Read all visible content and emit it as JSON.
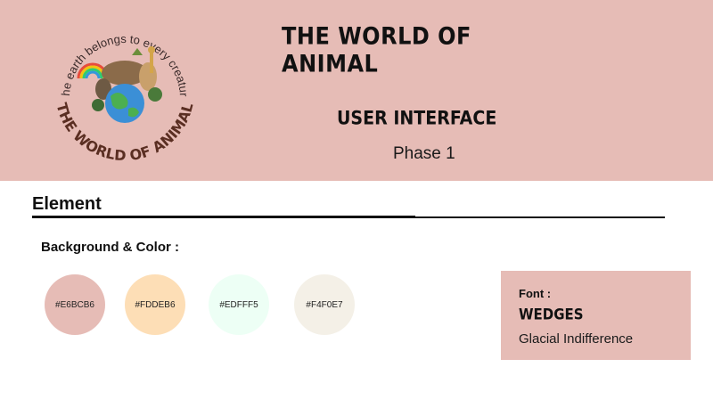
{
  "header": {
    "logo": {
      "arc_text": "The earth belongs to every creature",
      "bottom_text": "THE WORLD OF ANIMAL"
    },
    "title": "THE WORLD OF ANIMAL",
    "subtitle": "USER INTERFACE",
    "phase": "Phase 1"
  },
  "element": {
    "title": "Element",
    "background_label": "Background & Color :",
    "swatches": [
      {
        "label": "#E6BCB6",
        "color": "#E6BCB6"
      },
      {
        "label": "#FDDEB6",
        "color": "#FDDEB6"
      },
      {
        "label": "#EDFFF5",
        "color": "#EDFFF5"
      },
      {
        "label": "#F4F0E7",
        "color": "#F4F0E7"
      }
    ],
    "font": {
      "label": "Font :",
      "display_font": "WEDGES",
      "body_font": "Glacial Indifference"
    }
  }
}
